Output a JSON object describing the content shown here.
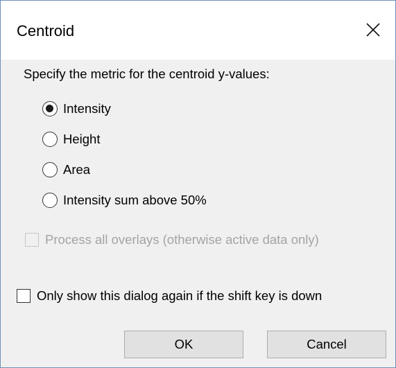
{
  "window": {
    "title": "Centroid"
  },
  "prompt": "Specify the metric for the centroid y-values:",
  "metrics": [
    {
      "label": "Intensity",
      "checked": true
    },
    {
      "label": "Height",
      "checked": false
    },
    {
      "label": "Area",
      "checked": false
    },
    {
      "label": "Intensity sum above 50%",
      "checked": false
    }
  ],
  "options": {
    "process_overlays": {
      "label": "Process all overlays (otherwise active data only)",
      "checked": false,
      "enabled": false
    },
    "shift_key": {
      "label": "Only show this dialog again if the shift key is down",
      "checked": false,
      "enabled": true
    }
  },
  "buttons": {
    "ok": "OK",
    "cancel": "Cancel"
  },
  "icons": {
    "close": "close-icon"
  }
}
